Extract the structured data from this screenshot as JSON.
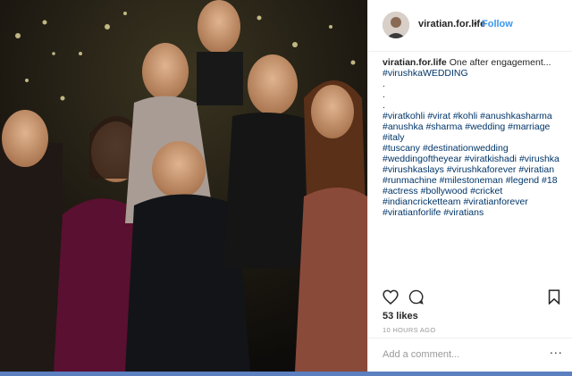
{
  "post": {
    "username": "viratian.for.life",
    "separator": "•",
    "follow_label": "Follow",
    "caption_text": "One after engagement...",
    "caption_lines": [
      [
        "#virushkaWEDDING"
      ],
      [
        "."
      ],
      [
        "."
      ],
      [
        "."
      ],
      [
        "#viratkohli",
        "#virat",
        "#kohli",
        "#anushkasharma"
      ],
      [
        "#anushka",
        "#sharma",
        "#wedding",
        "#marriage",
        "#italy"
      ],
      [
        "#tuscany",
        "#destinationwedding"
      ],
      [
        "#weddingoftheyear",
        "#viratkishadi",
        "#virushka"
      ],
      [
        "#virushkaslays",
        "#virushkaforever",
        "#viratian"
      ],
      [
        "#runmachine",
        "#milestoneman",
        "#legend",
        "#18"
      ],
      [
        "#actress",
        "#bollywood",
        "#cricket"
      ],
      [
        "#indiancricketteam",
        "#viratianforever"
      ],
      [
        "#viratianforlife",
        "#viratians"
      ]
    ],
    "likes": "53 likes",
    "timestamp": "10 HOURS AGO",
    "comment_placeholder": "Add a comment...",
    "more_glyph": "..."
  },
  "icons": {
    "like": "heart-icon",
    "comment": "comment-icon",
    "save": "bookmark-icon"
  },
  "colors": {
    "link": "#3897f0",
    "hashtag": "#003569",
    "text": "#262626",
    "muted": "#999999"
  }
}
